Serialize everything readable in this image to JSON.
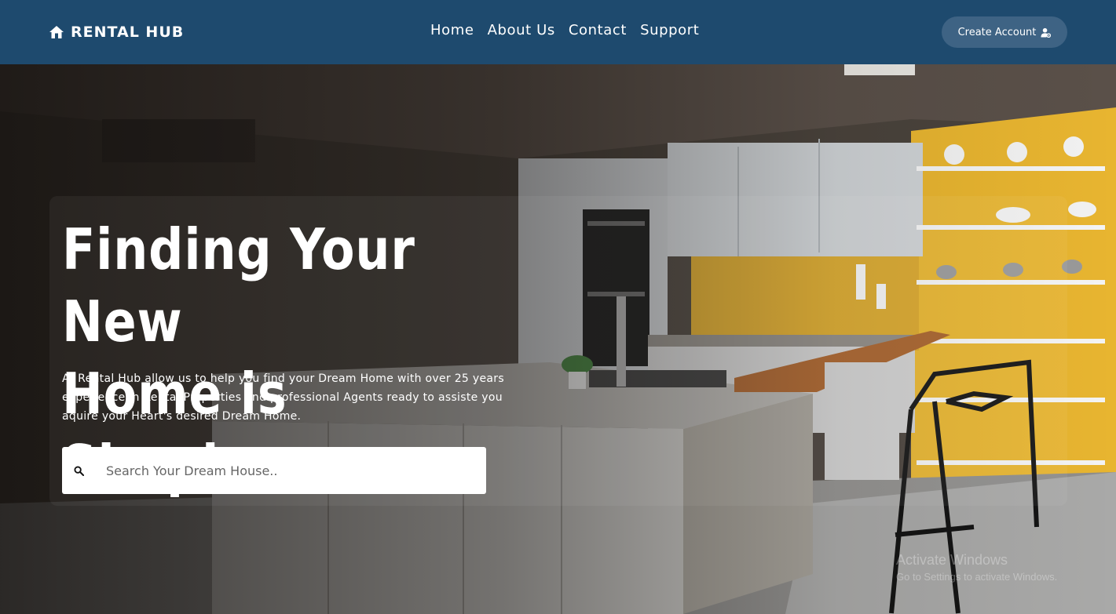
{
  "brand": {
    "name": "RENTAL HUB",
    "icon": "home-icon"
  },
  "nav": {
    "items": [
      {
        "label": "Home"
      },
      {
        "label": "About Us"
      },
      {
        "label": "Contact"
      },
      {
        "label": "Support"
      }
    ]
  },
  "account": {
    "label": "Create Account",
    "icon": "user-gear-icon"
  },
  "hero": {
    "title_line1": "Finding Your New",
    "title_line2": "Home is Simple",
    "description": "At Rental Hub allow us to help you find your Dream Home with over 25 years experience in Rental Properties and professional Agents ready to assiste you aquire your Heart's desired Dream Home."
  },
  "search": {
    "placeholder": "Search Your Dream House..",
    "value": "",
    "icon": "search-icon"
  },
  "watermark": {
    "line1": "Activate Windows",
    "line2": "Go to Settings to activate Windows."
  },
  "colors": {
    "navbar": "#1e4a6e",
    "button": "#3e6384",
    "accent_wall": "#e8b530"
  }
}
